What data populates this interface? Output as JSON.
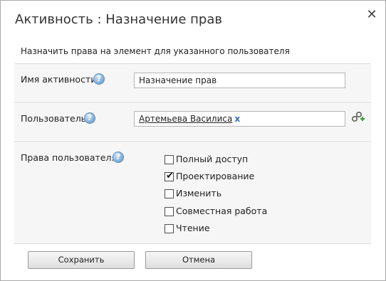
{
  "dialog": {
    "title": "Активность : Назначение прав",
    "close_glyph": "✕",
    "subtitle": "Назначить права на элемент для указанного пользователя"
  },
  "activity": {
    "label": "Имя активности",
    "value": "Назначение прав"
  },
  "user": {
    "label": "Пользователь",
    "selected_user": "Артемьева Василиса",
    "remove_glyph": "x",
    "picker_icon": "user-picker-icon"
  },
  "rights": {
    "label": "Права пользователя",
    "options": [
      {
        "label": "Полный доступ",
        "checked": false
      },
      {
        "label": "Проектирование",
        "checked": true
      },
      {
        "label": "Изменить",
        "checked": false
      },
      {
        "label": "Совместная работа",
        "checked": false
      },
      {
        "label": "Чтение",
        "checked": false
      }
    ]
  },
  "help_glyph": "?",
  "buttons": {
    "save": "Сохранить",
    "cancel": "Отмена"
  },
  "colors": {
    "row_background": "#f6f6f6",
    "link_accent": "#2b6fc0",
    "help_icon": "#6b9bd0"
  }
}
